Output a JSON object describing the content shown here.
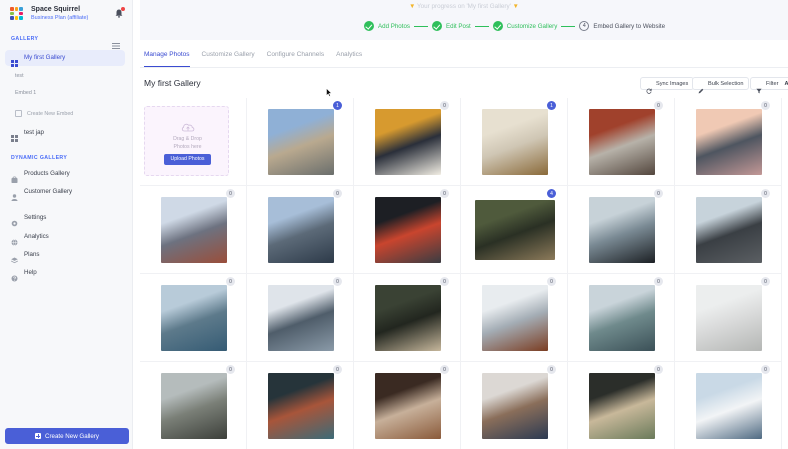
{
  "brand": {
    "name": "Space Squirrel",
    "plan": "Business Plan (affiliate)"
  },
  "sidebar": {
    "gallery_section": "GALLERY",
    "items": [
      {
        "label": "My first Gallery",
        "icon": "grid-icon",
        "active": true
      },
      {
        "label": "test",
        "sub": true
      },
      {
        "label": "Embed 1",
        "sub": true
      },
      {
        "label": "Create New Embed",
        "icon": "plus-square-icon"
      },
      {
        "label": "test jap",
        "icon": "grid-icon"
      }
    ],
    "dynamic_section": "DYNAMIC GALLERY",
    "dynamic_items": [
      {
        "label": "Products Gallery",
        "icon": "bag-icon"
      },
      {
        "label": "Customer Gallery",
        "icon": "person-icon"
      }
    ],
    "bottom_items": [
      {
        "label": "Settings",
        "icon": "gear-icon"
      },
      {
        "label": "Analytics",
        "icon": "globe-icon"
      },
      {
        "label": "Plans",
        "icon": "layers-icon"
      },
      {
        "label": "Help",
        "icon": "help-icon"
      }
    ],
    "create_button": "Create New Gallery"
  },
  "progress": {
    "title": "Your progress on 'My first Gallery'",
    "steps": [
      {
        "label": "Add Photos",
        "done": true
      },
      {
        "label": "Edit Post",
        "done": true
      },
      {
        "label": "Customize Gallery",
        "done": true
      },
      {
        "label": "Embed Gallery to Website",
        "done": false,
        "number": "4"
      }
    ]
  },
  "tabs": [
    {
      "label": "Manage Photos",
      "active": true
    },
    {
      "label": "Customize Gallery",
      "active": false
    },
    {
      "label": "Configure Channels",
      "active": false
    },
    {
      "label": "Analytics",
      "active": false
    }
  ],
  "gallery": {
    "title": "My first Gallery",
    "sync_button": "Sync Images",
    "bulk_button": "Bulk Selection",
    "filter_button": "Filter",
    "filter_overflow": "A"
  },
  "upload": {
    "line1": "Drag & Drop",
    "line2": "Photos here",
    "button": "Upload Photos"
  },
  "photos": [
    {
      "name": "castle-photo",
      "count": "1",
      "highlight": true,
      "colors": [
        "#8fb0d6",
        "#6a6e6c",
        "#b9a98f"
      ]
    },
    {
      "name": "coffee-cup-photo",
      "count": "0",
      "highlight": false,
      "colors": [
        "#d79a2f",
        "#f2eee4",
        "#2a2f3a"
      ]
    },
    {
      "name": "whiskey-glass-photo",
      "count": "1",
      "highlight": true,
      "colors": [
        "#e7e0d0",
        "#8a6a3a",
        "#cfc6b4"
      ]
    },
    {
      "name": "tram-street-photo",
      "count": "0",
      "highlight": false,
      "colors": [
        "#a0412c",
        "#53463d",
        "#b7b2a9"
      ]
    },
    {
      "name": "lake-sunset-photo",
      "count": "0",
      "highlight": false,
      "colors": [
        "#f0c9b4",
        "#c39896",
        "#4e5560"
      ]
    },
    {
      "name": "city-building-photo",
      "count": "0",
      "highlight": false,
      "colors": [
        "#cfd9e6",
        "#9a4e3a",
        "#6d7280"
      ]
    },
    {
      "name": "harbor-city-photo",
      "count": "0",
      "highlight": false,
      "colors": [
        "#a7bed8",
        "#2d3a49",
        "#5c6a78"
      ]
    },
    {
      "name": "car-night-photo",
      "count": "0",
      "highlight": false,
      "colors": [
        "#1d1f24",
        "#3a3c42",
        "#c9452e"
      ]
    },
    {
      "name": "deer-forest-photo",
      "count": "4",
      "highlight": true,
      "colors": [
        "#4f5a3c",
        "#8c7a5a",
        "#2a3024"
      ]
    },
    {
      "name": "car-wheel-photo",
      "count": "0",
      "highlight": false,
      "colors": [
        "#c7d2d8",
        "#1c2024",
        "#7a8a94"
      ]
    },
    {
      "name": "mountain-clouds-photo",
      "count": "0",
      "highlight": false,
      "colors": [
        "#c7d3db",
        "#5b5f63",
        "#3a3f44"
      ]
    },
    {
      "name": "person-lake-photo",
      "count": "0",
      "highlight": false,
      "colors": [
        "#b8cbd9",
        "#355b74",
        "#5d7a8b"
      ]
    },
    {
      "name": "skyscraper-photo",
      "count": "0",
      "highlight": false,
      "colors": [
        "#dfe4ea",
        "#8a9aa8",
        "#4f5d6a"
      ]
    },
    {
      "name": "woman-forest-photo",
      "count": "0",
      "highlight": false,
      "colors": [
        "#3a4234",
        "#c6b79c",
        "#22261f"
      ]
    },
    {
      "name": "horse-snow-photo",
      "count": "0",
      "highlight": false,
      "colors": [
        "#e8ecef",
        "#7b3d22",
        "#a4adb5"
      ]
    },
    {
      "name": "lake-mountain-photo",
      "count": "0",
      "highlight": false,
      "colors": [
        "#c9d4da",
        "#3b5057",
        "#6f8a8c"
      ]
    },
    {
      "name": "couple-snow-photo",
      "count": "0",
      "highlight": false,
      "colors": [
        "#eceeee",
        "#b4b6b4",
        "#d9dada"
      ]
    },
    {
      "name": "bridge-fog-photo",
      "count": "0",
      "highlight": false,
      "colors": [
        "#b5bcbc",
        "#3c3f3a",
        "#7a7f77"
      ]
    },
    {
      "name": "building-up-photo",
      "count": "0",
      "highlight": false,
      "colors": [
        "#26343a",
        "#3c6b78",
        "#a8553a"
      ]
    },
    {
      "name": "leather-tools-photo",
      "count": "0",
      "highlight": false,
      "colors": [
        "#3a2a22",
        "#8a5a3a",
        "#c7b09a"
      ]
    },
    {
      "name": "clothes-rack-photo",
      "count": "0",
      "highlight": false,
      "colors": [
        "#dcd8d4",
        "#2c3a52",
        "#8a6e5a"
      ]
    },
    {
      "name": "phone-food-photo",
      "count": "0",
      "highlight": false,
      "colors": [
        "#2b2e2a",
        "#6a7a5a",
        "#c8b89a"
      ]
    },
    {
      "name": "snow-mountain-photo",
      "count": "0",
      "highlight": false,
      "colors": [
        "#c9d9e6",
        "#4f6a82",
        "#f2f4f6"
      ]
    }
  ]
}
